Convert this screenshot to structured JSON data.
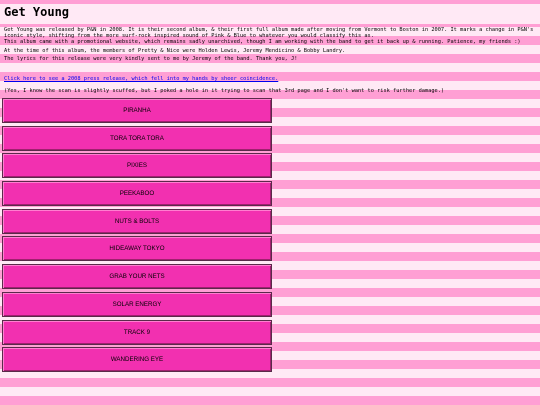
{
  "page": {
    "title": "Get Young"
  },
  "intro": {
    "p1": "Get Young was released by P&N in 2008. It is their second album, & their first full album made after moving from Vermont to Boston in 2007. It marks a change in P&N's iconic style, shifting from the more surf-rock inspired sound of Pink & Blue to whatever you would classify this as.",
    "p2": "This album came with a promotional website, which remains sadly unarchived, though I am working with the band to get it back up & running. Patience, my friends :)",
    "p3": "At the time of this album, the members of Pretty & Nice were Holden Lewis, Jeremy Mendicino & Bobby Landry.",
    "p4": "The lyrics for this release were very kindly sent to me by Jeremy of the band. Thank you, J!"
  },
  "press_link": {
    "label": "Click here to see a 2008 press release, which fell into my hands by sheer coincidence."
  },
  "scan_note": {
    "text": "(Yes, I know the scan is slightly scuffed, but I poked a hole in it trying to scan that 3rd page and I don't want to risk further damage.)"
  },
  "tracks": [
    "PIRANHA",
    "TORA TORA TORA",
    "PIXIES",
    "PEEKABOO",
    "NUTS & BOLTS",
    "HIDEAWAY TOKYO",
    "GRAB YOUR NETS",
    "SOLAR ENERGY",
    "TRACK 9",
    "WANDERING EYE"
  ],
  "colors": {
    "stripe_pink": "#ff9fd4",
    "stripe_light": "#ffe9f5",
    "button_fill": "#f230b0",
    "link": "#0000ee"
  }
}
